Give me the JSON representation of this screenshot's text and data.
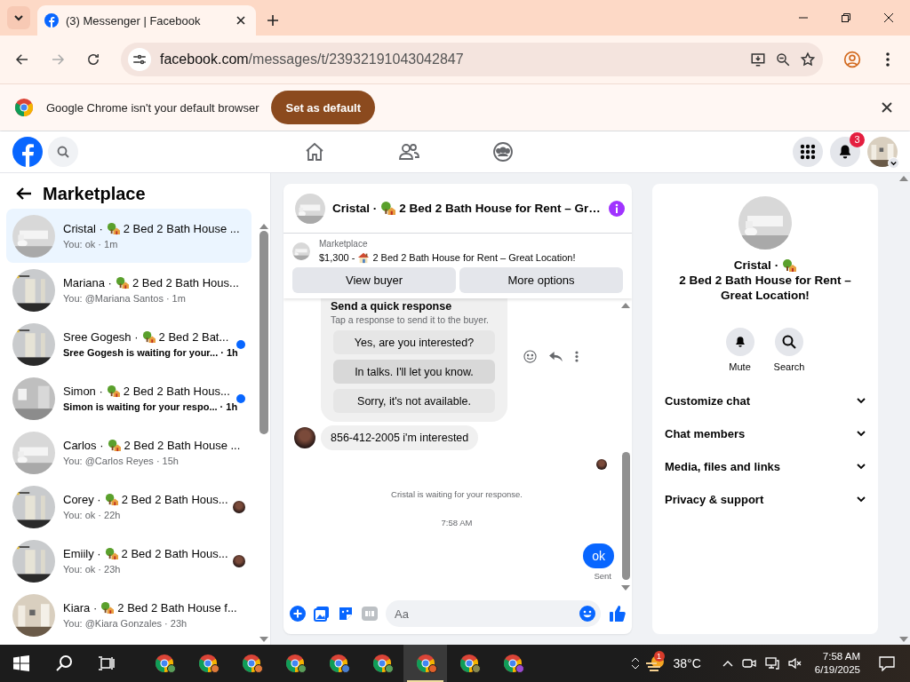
{
  "browser": {
    "tabs": [
      {
        "title": "(3) Messenger | Facebook",
        "selected": true
      }
    ],
    "url_host": "facebook.com",
    "url_path": "/messages/t/23932191043042847"
  },
  "infobar": {
    "message": "Google Chrome isn't your default browser",
    "button": "Set as default"
  },
  "facebook_header": {
    "notification_count": "3"
  },
  "chat_list": {
    "title": "Marketplace",
    "items": [
      {
        "name": "Cristal ·",
        "listing": "2 Bed 2 Bath House ...",
        "preview": "You: ok",
        "time": "· 1m",
        "selected": true,
        "unread": false,
        "seen_avatar": false
      },
      {
        "name": "Mariana ·",
        "listing": "2 Bed 2 Bath Hous...",
        "preview": "You: @Mariana Santos",
        "time": "· 1m",
        "selected": false,
        "unread": false,
        "seen_avatar": false
      },
      {
        "name": "Sree Gogesh ·",
        "listing": "2 Bed 2 Bat...",
        "preview": "Sree Gogesh is waiting for your...",
        "time": "· 1h",
        "selected": false,
        "unread": true,
        "seen_avatar": false
      },
      {
        "name": "Simon ·",
        "listing": "2 Bed 2 Bath Hous...",
        "preview": "Simon is waiting for your respo...",
        "time": "· 1h",
        "selected": false,
        "unread": true,
        "seen_avatar": false
      },
      {
        "name": "Carlos ·",
        "listing": "2 Bed 2 Bath House ...",
        "preview": "You: @Carlos Reyes",
        "time": "· 15h",
        "selected": false,
        "unread": false,
        "seen_avatar": false
      },
      {
        "name": "Corey ·",
        "listing": "2 Bed 2 Bath Hous...",
        "preview": "You: ok",
        "time": "· 22h",
        "selected": false,
        "unread": false,
        "seen_avatar": true
      },
      {
        "name": "Emiily ·",
        "listing": "2 Bed 2 Bath Hous...",
        "preview": "You: ok",
        "time": "· 23h",
        "selected": false,
        "unread": false,
        "seen_avatar": true
      },
      {
        "name": "Kiara ·",
        "listing": "2 Bed 2 Bath House f...",
        "preview": "You: @Kiara Gonzales",
        "time": "· 23h",
        "selected": false,
        "unread": false,
        "seen_avatar": false
      }
    ]
  },
  "conversation": {
    "name": "Cristal ·",
    "listing": "2 Bed 2 Bath House for Rent – Gr…",
    "banner": {
      "label": "Marketplace",
      "price": "$1,300 -",
      "listing": "2 Bed 2 Bath House for Rent – Great Location!",
      "buttons": [
        "View buyer",
        "More options"
      ]
    },
    "quick_response": {
      "title": "Send a quick response",
      "hint": "Tap a response to send it to the buyer.",
      "options": [
        {
          "text": "Yes, are you interested?",
          "highlighted": false
        },
        {
          "text": "In talks. I'll let you know.",
          "highlighted": true
        },
        {
          "text": "Sorry, it's not available.",
          "highlighted": false
        }
      ]
    },
    "messages": [
      {
        "kind": "incoming",
        "text": "856-412-2005 i'm interested"
      },
      {
        "kind": "notice",
        "text": "Cristal is waiting for your response."
      },
      {
        "kind": "timestamp",
        "text": "7:58 AM"
      },
      {
        "kind": "outgoing",
        "text": "ok",
        "status": "Sent"
      }
    ],
    "composer": {
      "placeholder": "Aa"
    }
  },
  "info_panel": {
    "name": "Cristal ·",
    "listing": "2 Bed 2 Bath House for Rent – Great Location!",
    "actions": [
      {
        "kind": "mute",
        "label": "Mute"
      },
      {
        "kind": "search",
        "label": "Search"
      }
    ],
    "sections": [
      {
        "label": "Customize chat",
        "expanded": false
      },
      {
        "label": "Chat members",
        "expanded": false
      },
      {
        "label": "Media, files and links",
        "expanded": false
      },
      {
        "label": "Privacy & support",
        "expanded": false
      }
    ]
  },
  "taskbar": {
    "apps": [
      {
        "color": "#5a9e5a",
        "selected": false
      },
      {
        "color": "#e07a3a",
        "selected": false
      },
      {
        "color": "#e07a3a",
        "selected": false
      },
      {
        "color": "#5a9e5a",
        "selected": false
      },
      {
        "color": "#4a7fd0",
        "selected": false
      },
      {
        "color": "#5a9e5a",
        "selected": false
      },
      {
        "color": "#e0602a",
        "selected": true
      },
      {
        "color": "#8a8a50",
        "selected": false
      },
      {
        "color": "#9a4ad0",
        "selected": false
      }
    ],
    "weather_badge": "1",
    "temperature": "38°C",
    "time": "7:58 AM",
    "date": "6/19/2025"
  }
}
